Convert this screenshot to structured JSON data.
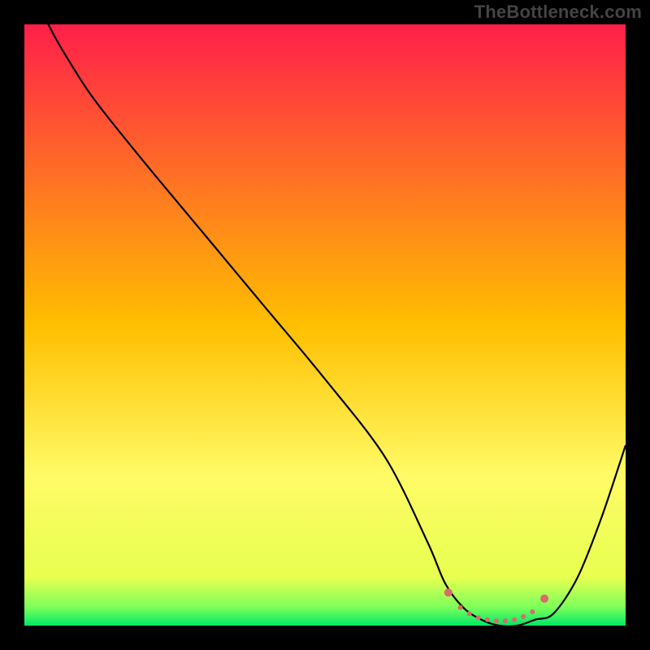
{
  "attribution": "TheBottleneck.com",
  "chart_data": {
    "type": "line",
    "title": "",
    "xlabel": "",
    "ylabel": "",
    "xlim": [
      0,
      100
    ],
    "ylim": [
      0,
      100
    ],
    "grid": false,
    "legend": false,
    "gradient_stops": [
      {
        "offset": 0.0,
        "color": "#ff1f4a"
      },
      {
        "offset": 0.5,
        "color": "#ffbf00"
      },
      {
        "offset": 0.75,
        "color": "#fffb66"
      },
      {
        "offset": 0.92,
        "color": "#e7ff4f"
      },
      {
        "offset": 0.97,
        "color": "#7aff5a"
      },
      {
        "offset": 1.0,
        "color": "#00e868"
      }
    ],
    "series": [
      {
        "name": "bottleneck-curve",
        "color": "#000000",
        "x": [
          0,
          4,
          8,
          12,
          20,
          30,
          40,
          50,
          60,
          67,
          70,
          73,
          76,
          79,
          82,
          85,
          88,
          92,
          96,
          100
        ],
        "y": [
          110,
          100,
          93,
          87,
          77,
          65,
          53,
          41,
          28,
          14,
          7,
          3,
          1,
          0,
          0,
          1,
          2,
          8,
          18,
          30
        ]
      }
    ],
    "markers": {
      "name": "optimal-range",
      "color": "#d96a6a",
      "radius_primary": 5,
      "radius_secondary": 3,
      "points": [
        {
          "x": 70.5,
          "y": 5.5,
          "r": "primary"
        },
        {
          "x": 72.5,
          "y": 3.0,
          "r": "secondary"
        },
        {
          "x": 74.0,
          "y": 2.0,
          "r": "secondary"
        },
        {
          "x": 75.5,
          "y": 1.3,
          "r": "secondary"
        },
        {
          "x": 77.0,
          "y": 1.0,
          "r": "secondary"
        },
        {
          "x": 78.5,
          "y": 0.8,
          "r": "secondary"
        },
        {
          "x": 80.0,
          "y": 0.8,
          "r": "secondary"
        },
        {
          "x": 81.5,
          "y": 1.0,
          "r": "secondary"
        },
        {
          "x": 83.0,
          "y": 1.5,
          "r": "secondary"
        },
        {
          "x": 84.5,
          "y": 2.3,
          "r": "secondary"
        },
        {
          "x": 86.5,
          "y": 4.5,
          "r": "primary"
        }
      ]
    }
  }
}
